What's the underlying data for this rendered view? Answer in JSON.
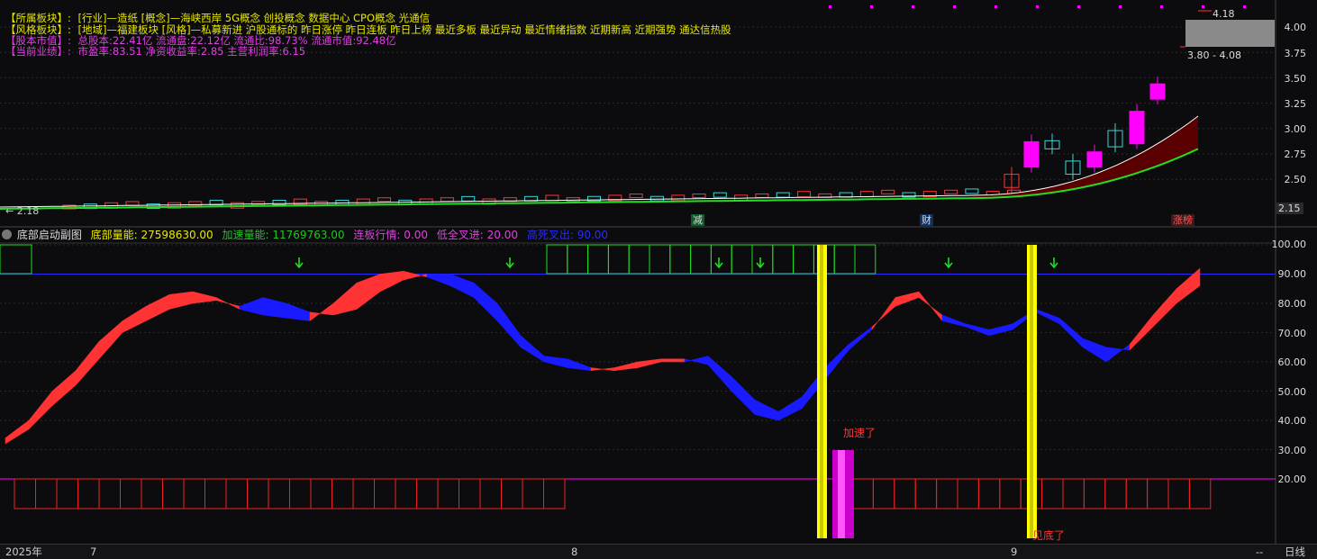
{
  "info": {
    "sector": {
      "key": "【所属板块】:",
      "value": "[行业]—造纸 [概念]—海峡西岸 5G概念 创投概念 数据中心 CPO概念 光通信"
    },
    "style": {
      "key": "【风格板块】:",
      "value": "[地域]—福建板块 [风格]—私募新进 沪股通标的 昨日涨停 昨日连板 昨日上榜 最近多板 最近异动 最近情绪指数 近期新高 近期强势 通达信热股"
    },
    "cap": {
      "key": "【股本市值】:",
      "value": "总股本:22.41亿 流通盘:22.12亿 流通比:98.73% 流通市值:92.48亿"
    },
    "perf": {
      "key": "【当前业绩】:",
      "value": "市盈率:83.51 净资收益率:2.85 主营利润率:6.15"
    }
  },
  "main_axis": [
    "4.00",
    "3.75",
    "3.50",
    "3.25",
    "3.00",
    "2.75",
    "2.50"
  ],
  "price_marks": {
    "high": "4.18",
    "range": "3.80 - 4.08",
    "low": "2.18",
    "current": "2.15"
  },
  "badges": {
    "jian": "减",
    "cai": "财",
    "zhangbang": "涨榜"
  },
  "sub_legend": {
    "title": "底部启动副图",
    "items": [
      {
        "label": "底部量能: 27598630.00",
        "color": "#e8e800"
      },
      {
        "label": "加速量能: 11769763.00",
        "color": "#22c522"
      },
      {
        "label": "连板行情: 0.00",
        "color": "#e040e0"
      },
      {
        "label": "低全叉进: 20.00",
        "color": "#e040e0"
      },
      {
        "label": "高死叉出: 90.00",
        "color": "#2a2aff"
      }
    ]
  },
  "sub_axis": [
    "100.00",
    "90.00",
    "80.00",
    "70.00",
    "60.00",
    "50.00",
    "40.00",
    "30.00",
    "20.00"
  ],
  "annotations": {
    "accelerate": "加速了",
    "bottom": "见底了"
  },
  "x_axis": {
    "year": "2025年",
    "m7": "7",
    "m8": "8",
    "m9": "9",
    "period": "日线",
    "more": "--"
  },
  "colors": {
    "up": "#ff3333",
    "down": "#1a1aff",
    "yellow": "#ffff00",
    "magenta": "#ff00ff",
    "green": "#22dd22"
  },
  "chart_data": {
    "type": "line",
    "title": "底部启动副图",
    "ylim": [
      10,
      100
    ],
    "series": [
      {
        "name": "底部量能",
        "values": [
          32,
          37,
          45,
          52,
          61,
          70,
          74,
          78,
          80,
          81,
          79,
          82,
          80,
          77,
          76,
          78,
          84,
          88,
          90,
          90,
          87,
          80,
          69,
          62,
          61,
          58,
          57,
          58,
          60,
          60,
          62,
          55,
          47,
          43,
          48,
          58,
          66,
          72,
          79,
          82,
          76,
          73,
          71,
          73,
          78,
          75,
          68,
          65,
          64,
          72,
          80,
          86
        ]
      },
      {
        "name": "加速量能",
        "values": [
          34,
          40,
          50,
          57,
          67,
          74,
          79,
          83,
          84,
          82,
          78,
          76,
          75,
          74,
          80,
          87,
          90,
          91,
          89,
          86,
          82,
          74,
          65,
          60,
          58,
          57,
          58,
          60,
          61,
          61,
          59,
          50,
          42,
          40,
          44,
          54,
          64,
          71,
          82,
          84,
          74,
          72,
          69,
          71,
          77,
          73,
          65,
          60,
          66,
          76,
          85,
          92
        ]
      }
    ]
  }
}
